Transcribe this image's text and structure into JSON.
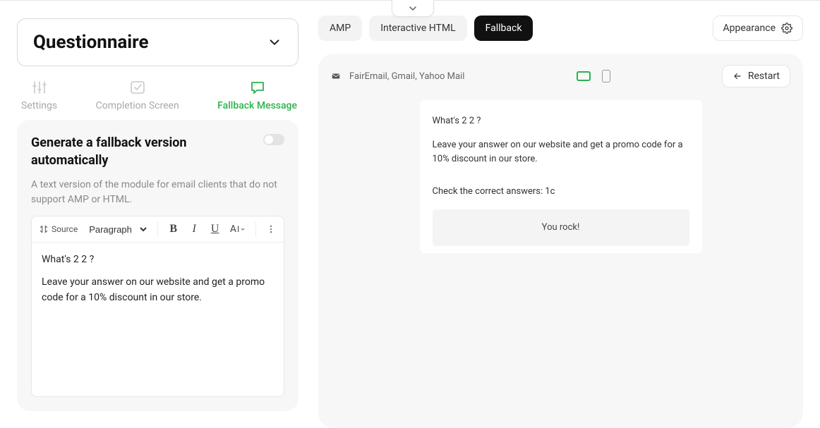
{
  "module": {
    "title": "Questionnaire"
  },
  "left_tabs": {
    "settings": "Settings",
    "completion": "Completion Screen",
    "fallback": "Fallback Message"
  },
  "fallback_panel": {
    "title": "Generate a fallback version automatically",
    "description": "A text version of the module for email clients that do not support AMP or HTML."
  },
  "editor_toolbar": {
    "source_label": "Source",
    "style_select": "Paragraph"
  },
  "editor_body": {
    "q": "What's 2 2 ?",
    "cta": "Leave your answer on our website and get a promo code for a 10% discount in our store."
  },
  "right_tabs": {
    "amp": "AMP",
    "ihtml": "Interactive HTML",
    "fallback": "Fallback"
  },
  "appearance_btn": "Appearance",
  "preview_bar": {
    "clients": "FairEmail, Gmail, Yahoo Mail",
    "restart": "Restart"
  },
  "preview_body": {
    "q": "What's 2 2 ?",
    "cta": "Leave your answer on our website and get a promo code for a 10% discount in our store.",
    "check": "Check the correct answers: 1c",
    "rock": "You rock!"
  }
}
